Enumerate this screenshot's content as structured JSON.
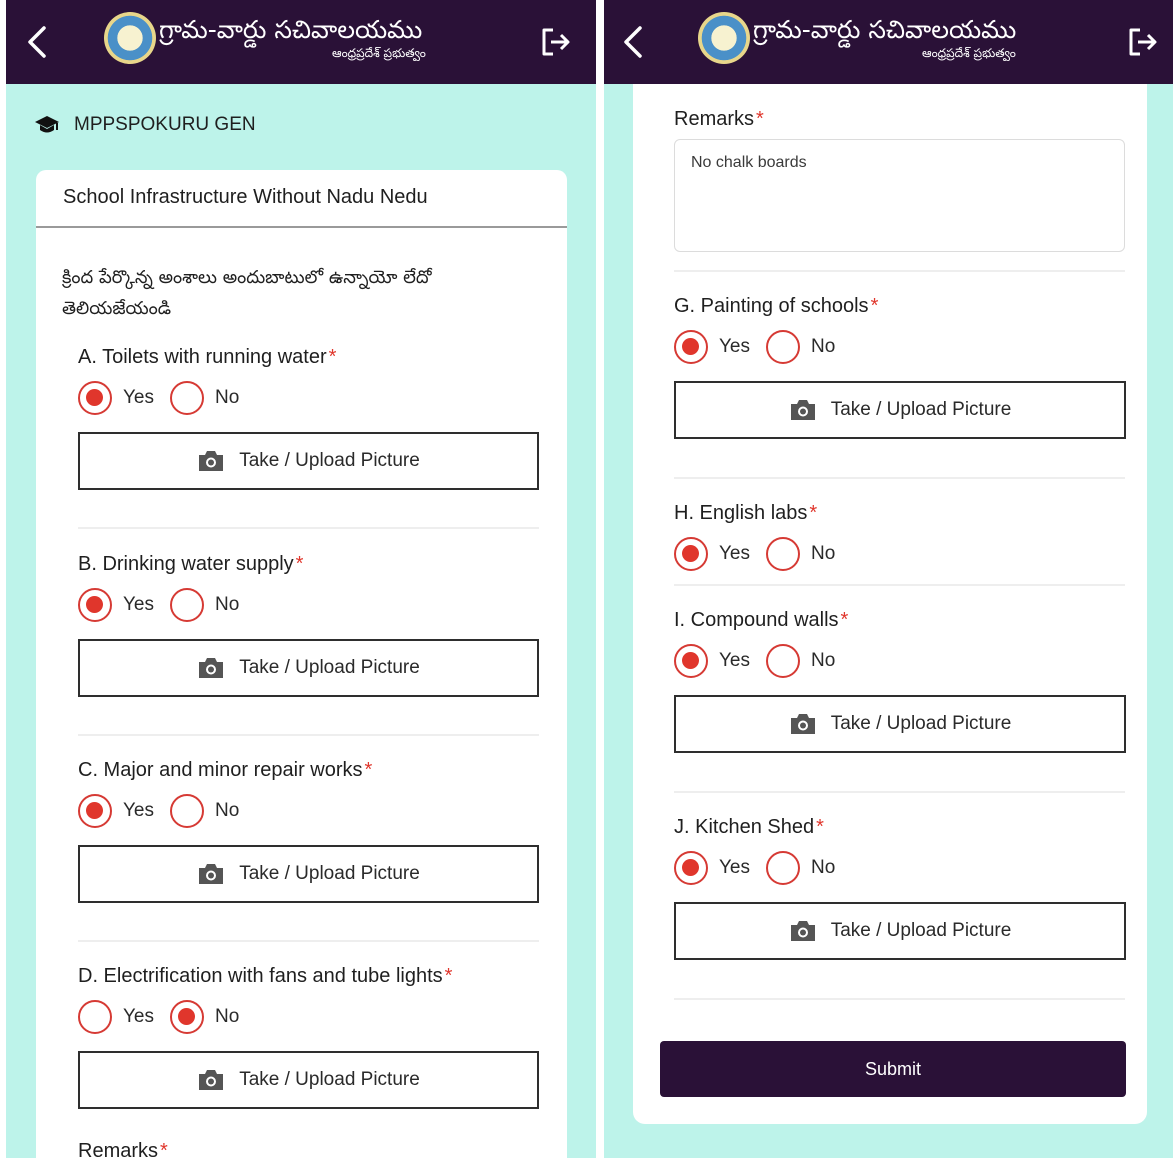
{
  "app": {
    "brand_title": "గ్రామ-వార్డు సచివాలయము",
    "brand_subtitle": "ఆంధ్రప్రదేశ్ ప్రభుత్వం"
  },
  "icons": {
    "back": "chevron-left-icon",
    "logout": "logout-icon",
    "school": "graduation-cap-icon",
    "camera": "camera-icon",
    "emblem": "state-emblem"
  },
  "colors": {
    "header_bg": "#2a1137",
    "page_bg": "#bdf3ea",
    "radio_selected": "#e0362c",
    "required_star": "#e0362c"
  },
  "school_name": "MPPSPOKURU GEN",
  "form": {
    "title": "School Infrastructure Without Nadu Nedu",
    "instruction": "క్రింద పేర్కొన్న అంశాలు అందుబాటులో ఉన్నాయో లేదో తెలియజేయండి",
    "required_marker": "*",
    "yes_label": "Yes",
    "no_label": "No",
    "upload_label": "Take / Upload Picture",
    "remarks_label": "Remarks",
    "remarks_value": "No chalk boards",
    "submit_label": "Submit",
    "questions": [
      {
        "label": "A. Toilets with running water",
        "selected": "Yes"
      },
      {
        "label": "B. Drinking water supply",
        "selected": "Yes"
      },
      {
        "label": "C. Major and minor repair works",
        "selected": "Yes"
      },
      {
        "label": "D. Electrification with fans and tube lights",
        "selected": "No"
      },
      {
        "label": "G. Painting of schools",
        "selected": "Yes"
      },
      {
        "label": "H. English labs",
        "selected": "Yes"
      },
      {
        "label": "I. Compound walls",
        "selected": "Yes"
      },
      {
        "label": "J. Kitchen Shed",
        "selected": "Yes"
      }
    ]
  }
}
